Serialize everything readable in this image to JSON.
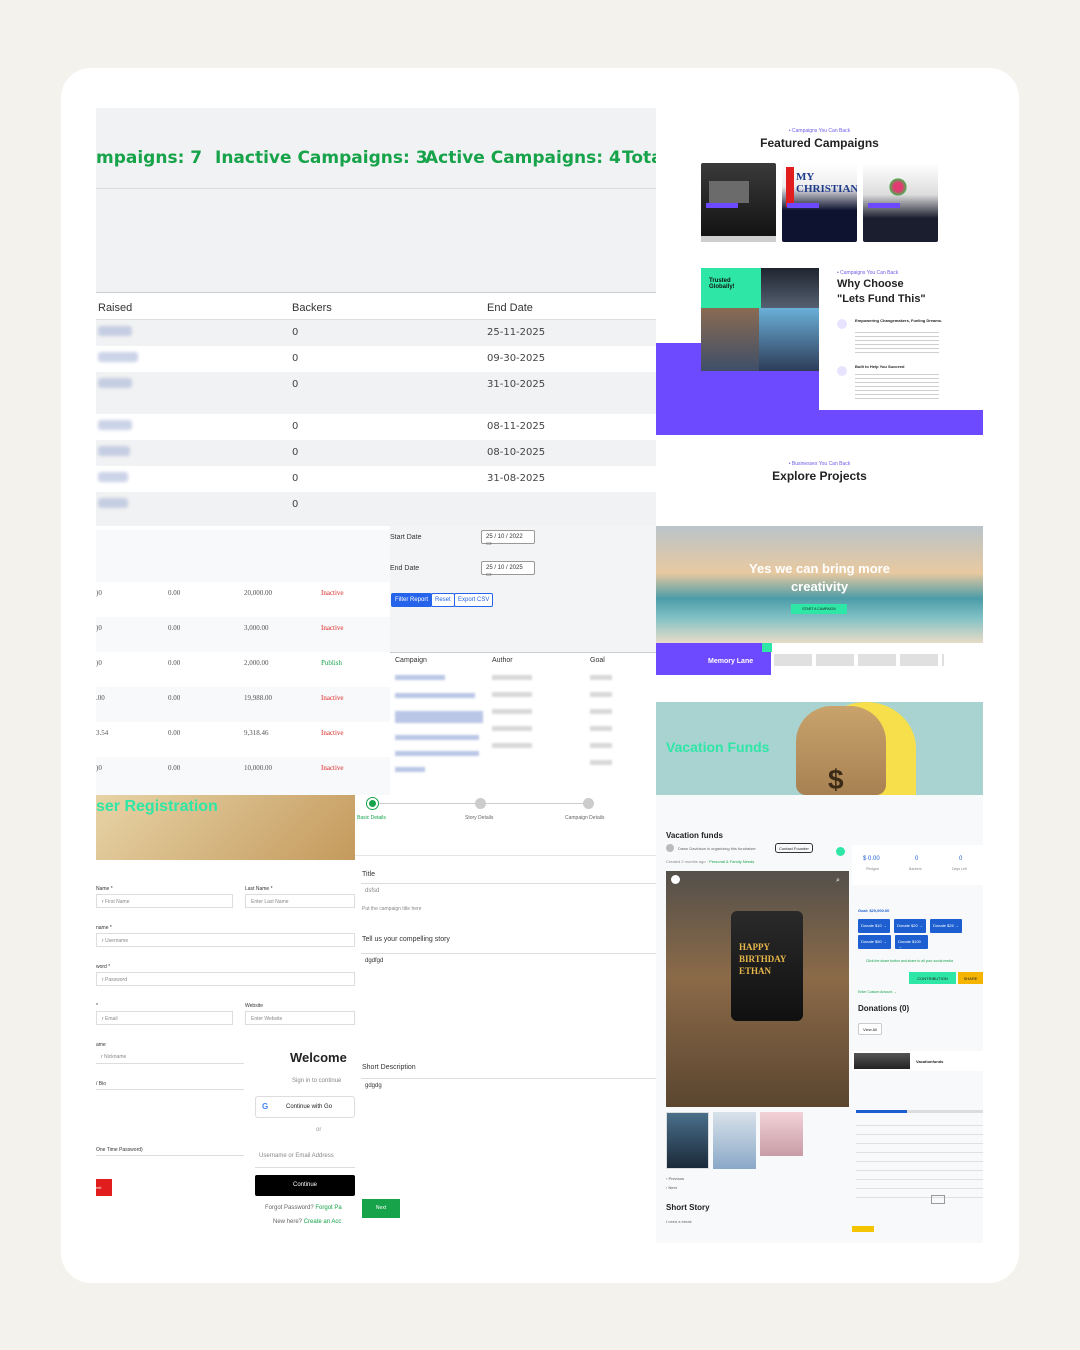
{
  "stats": {
    "total_campaigns": "mpaigns: 7",
    "inactive_campaigns": "Inactive Campaigns: 3",
    "active_campaigns": "Active Campaigns: 4",
    "total_cut": "Tota"
  },
  "campaign_table": {
    "headers": [
      "Raised",
      "Backers",
      "End Date"
    ],
    "rows": [
      {
        "backers": "0",
        "end_date": "25-11-2025"
      },
      {
        "backers": "0",
        "end_date": "09-30-2025"
      },
      {
        "backers": "0",
        "end_date": "31-10-2025"
      },
      {
        "backers": "0",
        "end_date": "08-11-2025"
      },
      {
        "backers": "0",
        "end_date": "08-10-2025"
      },
      {
        "backers": "0",
        "end_date": "31-08-2025"
      },
      {
        "backers": "0",
        "end_date": ""
      }
    ]
  },
  "report_table": {
    "rows": [
      {
        "c1": ")0",
        "c2": "0.00",
        "c3": "20,000.00",
        "status": "Inactive"
      },
      {
        "c1": ")0",
        "c2": "0.00",
        "c3": "3,000.00",
        "status": "Inactive"
      },
      {
        "c1": ")0",
        "c2": "0.00",
        "c3": "2,000.00",
        "status": "Publish"
      },
      {
        "c1": ".00",
        "c2": "0.00",
        "c3": "19,988.00",
        "status": "Inactive"
      },
      {
        "c1": "3.54",
        "c2": "0.00",
        "c3": "9,318.46",
        "status": "Inactive"
      },
      {
        "c1": ")0",
        "c2": "0.00",
        "c3": "10,000.00",
        "status": "Inactive"
      }
    ]
  },
  "filter": {
    "start_date_label": "Start Date",
    "start_date_value": "25 / 10 / 2022",
    "end_date_label": "End Date",
    "end_date_value": "25 / 10 / 2025",
    "filter_button": "Filter Report",
    "reset_button": "Reset",
    "export_button": "Export CSV",
    "headers": [
      "Campaign",
      "Author",
      "Goal"
    ]
  },
  "featured": {
    "kicker": "• Campaigns You Can Back",
    "title": "Featured Campaigns",
    "why_kicker": "• Campaigns You Can Back",
    "why_title_line1": "Why Choose",
    "why_title_line2": "\"Lets Fund This\"",
    "trusted_badge": "Trusted Globally!",
    "point1_title": "Empowering Changemakers, Fueling Dreams.",
    "point2_title": "Built to Help You Succeed"
  },
  "explore": {
    "kicker": "• Businesses You Can Back",
    "title": "Explore Projects",
    "hero_line1": "Yes we can bring more",
    "hero_line2": "creativity",
    "hero_button": "START A CAMPAIGN",
    "memory_lane": "Memory Lane"
  },
  "vacation_banner": {
    "title": "Vacation Funds"
  },
  "registration": {
    "title": "ser Registration",
    "first_name_label": "Name *",
    "first_name_placeholder": "r First Name",
    "last_name_label": "Last Name *",
    "last_name_placeholder": "Enter Last Name",
    "username_label": "name *",
    "username_placeholder": "r Username",
    "password_label": "word *",
    "password_placeholder": "r Password",
    "email_label": "*",
    "email_placeholder": "r Email",
    "website_label": "Website",
    "website_placeholder": "Enter Website",
    "nickname_label": "ame",
    "nickname_placeholder": "r Nickname",
    "bio_label": "/ Bio",
    "otp_label": "One Time Password)",
    "red_button": "mit"
  },
  "login": {
    "title": "Welcome",
    "subtitle": "Sign in to continue",
    "google_button": "Continue with Go",
    "or": "or",
    "username_placeholder": "Username or Email Address",
    "continue_button": "Continue",
    "forgot_prefix": "Forgot Password?",
    "forgot_link": "Forgot Pa",
    "new_prefix": "New here?",
    "create_link": "Create an Acc"
  },
  "story_form": {
    "steps": [
      "Basic Details",
      "Story Details",
      "Campaign Details"
    ],
    "title_label": "Title",
    "title_value": "dsfsd",
    "title_help": "Put the campaign title here",
    "story_label": "Tell us your compelling story",
    "story_value": "dgdfgd",
    "short_desc_label": "Short Description",
    "short_desc_value": "gdgdg",
    "next_button": "Next"
  },
  "donation": {
    "title": "Vacation funds",
    "organizer": "Dawn Davidson is organizing this fundraiser",
    "contact_button": "Contact Founder",
    "created": "Created 2 months ago",
    "category": "Personal & Family Needs",
    "pledged_value": "$ 0.00",
    "pledged_label": "Pledged",
    "backers_value": "0",
    "backers_label": "Backers",
    "days_value": "0",
    "days_label": "Days Left",
    "goal": "Goal: $20,000.00",
    "donate_buttons": [
      "Donate $10 →",
      "Donate $20 →",
      "Donate $25 →",
      "Donate $50 →",
      "Donate $100 →"
    ],
    "share_note": "Click the share button and share to all your social media",
    "contribution_button": "CONTRIBUTION",
    "share_button": "SHARE",
    "custom_amount": "Enter Custom Amount →",
    "donations_heading": "Donations (0)",
    "view_all": "View All",
    "cake_text_line1": "HAPPY",
    "cake_text_line2": "BIRTHDAY",
    "cake_text_line3": "ETHAN",
    "previous": "Previous",
    "next": "Next",
    "short_story_heading": "Short Story",
    "short_story_text": "I need a break",
    "card_title": "Vacationfunds"
  },
  "colors": {
    "accent_green": "#16a34a",
    "brand_purple": "#6d4aff",
    "teal": "#2ee6a6"
  }
}
